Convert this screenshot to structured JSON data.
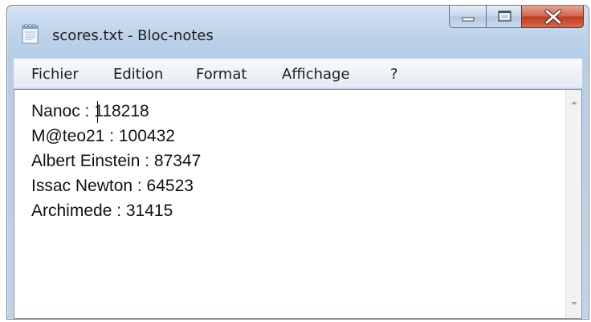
{
  "window": {
    "title": "scores.txt - Bloc-notes"
  },
  "menu": {
    "items": [
      "Fichier",
      "Edition",
      "Format",
      "Affichage",
      "?"
    ]
  },
  "document": {
    "lines": [
      "Nanoc : 118218",
      "M@teo21 : 100432",
      "Albert Einstein : 87347",
      "Issac Newton : 64523",
      "Archimede : 31415"
    ]
  },
  "icons": {
    "app": "notepad-icon",
    "minimize": "minimize-icon",
    "maximize": "maximize-icon",
    "close": "close-icon",
    "scroll_up": "chevron-up-icon",
    "scroll_down": "chevron-down-icon"
  },
  "colors": {
    "titlebar": "#bcd2ea",
    "close_button": "#c03a1e",
    "menubar": "#eef2f8",
    "editor_background": "#ffffff"
  }
}
